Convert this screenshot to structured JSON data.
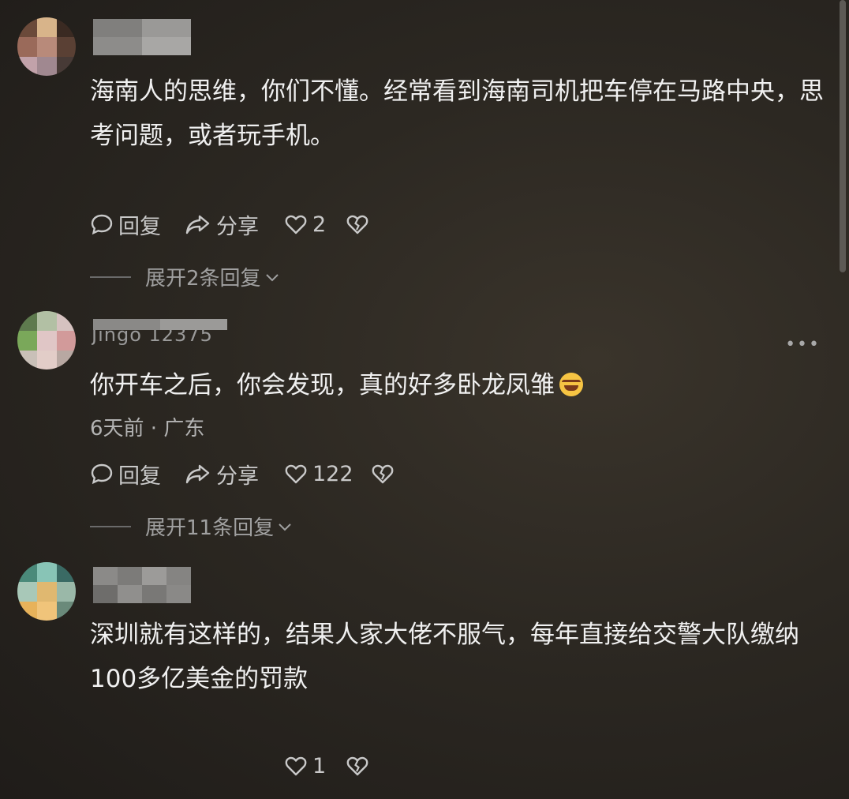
{
  "comments": [
    {
      "username": "",
      "text": "海南人的思维，你们不懂。经常看到海南司机把车停在马路中央，思考问题，或者玩手机。",
      "actions": {
        "reply": "回复",
        "share": "分享",
        "likes": "2"
      },
      "expand": "展开2条回复"
    },
    {
      "username": "Jingo 12375",
      "text": "你开车之后，你会发现，真的好多卧龙凤雏",
      "emoji": "rolling-on-floor-laughing-emoji",
      "meta": "6天前 · 广东",
      "more": "•••",
      "actions": {
        "reply": "回复",
        "share": "分享",
        "likes": "122"
      },
      "expand": "展开11条回复"
    },
    {
      "username": "",
      "text": "深圳就有这样的，结果人家大佬不服气，每年直接给交警大队缴纳100多亿美金的罚款",
      "actions": {
        "likes": "1"
      }
    }
  ]
}
